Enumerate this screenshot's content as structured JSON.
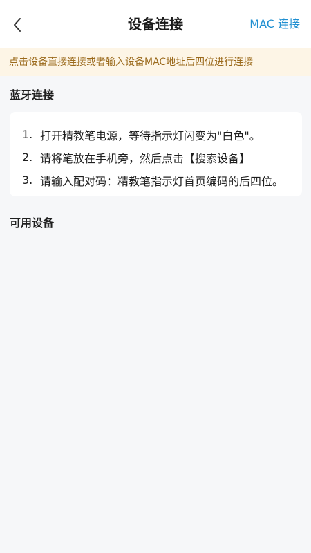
{
  "header": {
    "back_icon": "chevron-left-icon",
    "title": "设备连接",
    "mac_link": "MAC 连接"
  },
  "notice": {
    "text": "点击设备直接连接或者输入设备MAC地址后四位进行连接"
  },
  "bluetooth": {
    "title": "蓝牙连接",
    "steps": [
      {
        "num": "1.",
        "text": "打开精教笔电源，等待指示灯闪变为\"白色\"。"
      },
      {
        "num": "2.",
        "text": "请将笔放在手机旁，然后点击【搜索设备】"
      },
      {
        "num": "3.",
        "text": "请输入配对码：精教笔指示灯首页编码的后四位。"
      }
    ]
  },
  "available": {
    "title": "可用设备"
  },
  "colors": {
    "accent": "#1f8fd1",
    "notice_bg": "#fdf5e6",
    "notice_text": "#9b6a1c",
    "page_bg": "#f6f7f9"
  }
}
